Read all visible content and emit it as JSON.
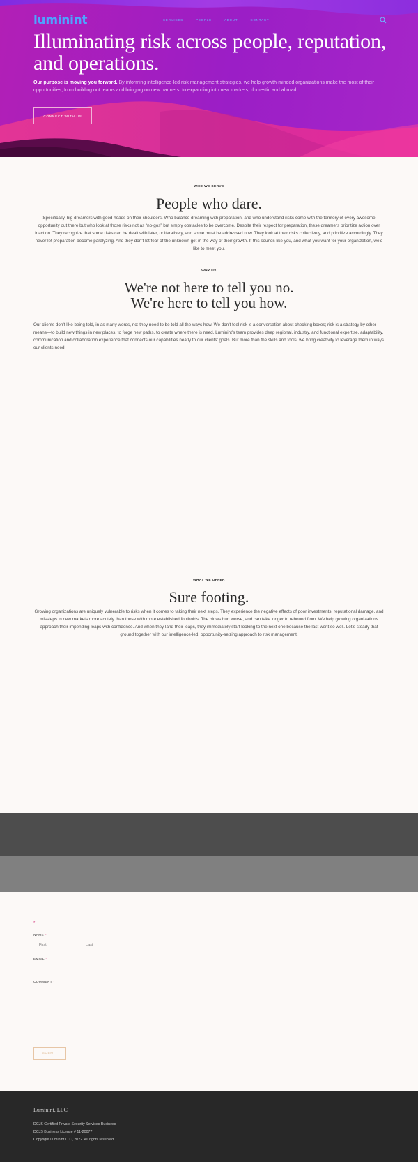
{
  "header": {
    "logo": "luminint",
    "nav": [
      "SERVICES",
      "PEOPLE",
      "ABOUT",
      "CONTACT"
    ]
  },
  "hero": {
    "title": "Illuminating risk across people, reputation, and operations.",
    "intro_bold": "Our purpose is moving you forward.",
    "intro_rest": " By informing intelligence-led risk management strategies, we help growth-minded organizations make the most of their opportunities, from building out teams and bringing on new partners, to expanding into new markets, domestic and abroad.",
    "cta": "CONNECT WITH US"
  },
  "who_we_serve": {
    "eyebrow": "WHO WE SERVE",
    "heading": "People who dare.",
    "body": "Specifically, big dreamers with good heads on their shoulders. Who balance dreaming with preparation, and who understand risks come with the territory of every awesome opportunity out there but who look at those risks not as “no-gos” but simply obstacles to be overcome. Despite their respect for preparation, these dreamers prioritize action over inaction. They recognize that some risks can be dealt with later, or iteratively, and some must be addressed now. They look at their risks collectively, and prioritize accordingly. They never let preparation become paralyzing. And they don’t let fear of the unknown get in the way of their growth. If this sounds like you, and what you want for your organization, we’d like to meet you."
  },
  "why_us": {
    "eyebrow": "WHY US",
    "heading_line1": "We're not here to tell you no.",
    "heading_line2": "We're here to tell you how.",
    "body": "Our clients don’t like being told, in as many words, no: they need to be told all the ways how. We don’t feel risk is a conversation about checking boxes; risk is a strategy by other means—to build new things in new places, to forge new paths, to create where there is need. Luminint’s team provides deep regional, industry, and functional expertise, adaptability, communication and collaboration experience that connects our capabilities neatly to our clients’ goals. But more than the skills and tools, we bring creativity to leverage them in ways our clients need."
  },
  "what_we_offer": {
    "eyebrow": "WHAT WE OFFER",
    "heading": "Sure footing.",
    "body": "Growing organizations are uniquely vulnerable to risks when it comes to taking their next steps. They experience the negative effects of poor investments, reputational damage, and missteps in new markets more acutely than those with more established footholds. The blows hurt worse, and can take longer to rebound from. We help growing organizations approach their impending leaps with confidence. And when they land their leaps, they immediately start looking to the next one because the last went so well. Let’s steady that ground together with our intelligence-led, opportunity-seizing approach to risk management."
  },
  "form": {
    "required_mark": "*",
    "name_label": "NAME",
    "first_placeholder": "First",
    "last_placeholder": "Last",
    "email_label": "EMAIL",
    "comment_label": "COMMENT",
    "submit": "SUBMIT"
  },
  "footer": {
    "brand": "Luminint, LLC",
    "line1": "DCJS Certified Private Security Services Business",
    "line2": "DCJS Business License # 11-20077",
    "line3": "Copyright Luminint LLC, 2022.  All rights reserved."
  },
  "colors": {
    "hero_purple": "#9b1ec6",
    "hero_magenta": "#e0279b",
    "logo_blue": "#4fa3ff",
    "page_bg": "#fcf9f7",
    "footer_bg": "#282828"
  }
}
